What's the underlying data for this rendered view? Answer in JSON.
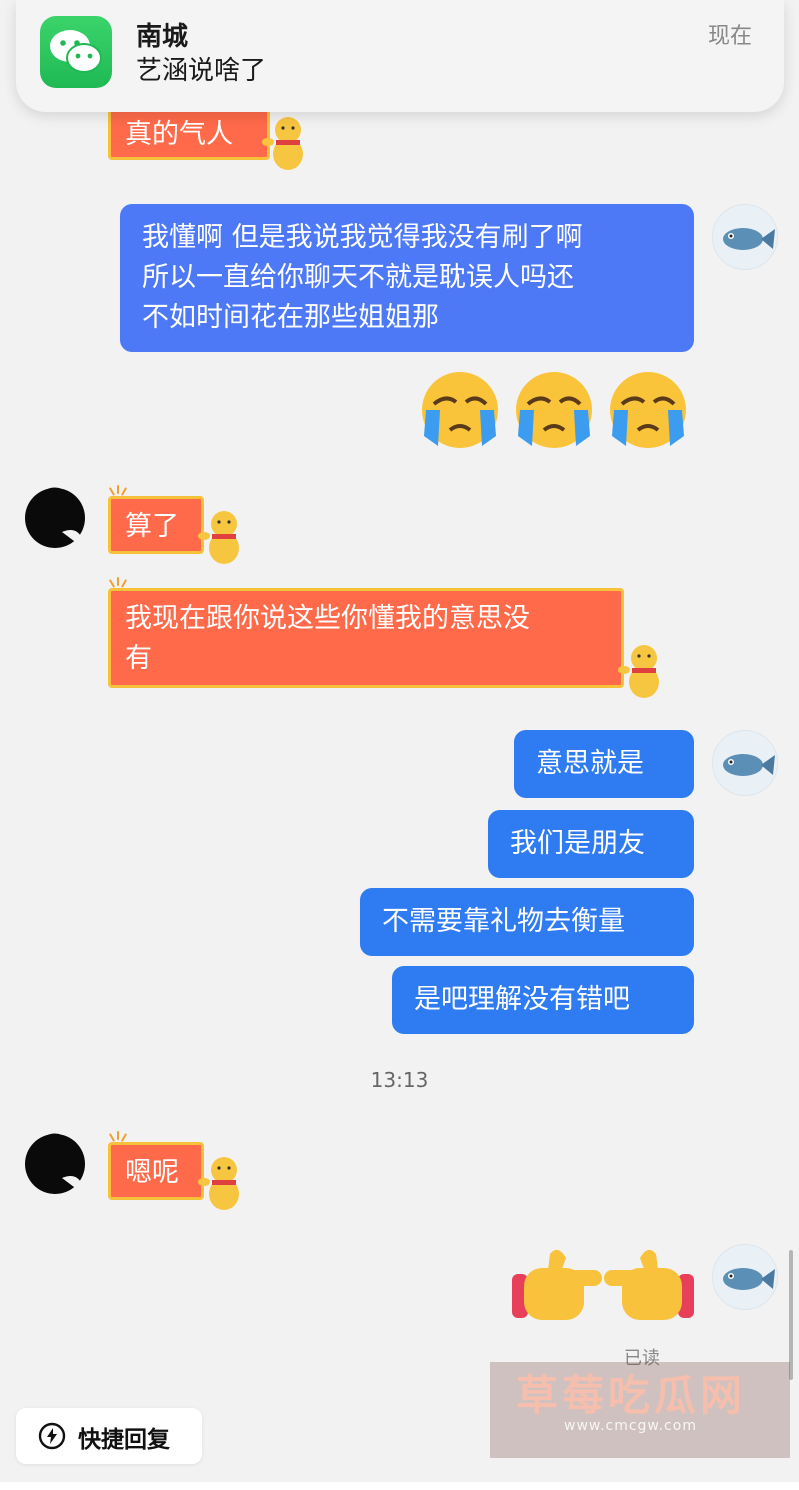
{
  "notification": {
    "app_icon": "wechat-icon",
    "title": "南城",
    "message": "艺涵说啥了",
    "time": "现在"
  },
  "messages": {
    "m0": "真的气人",
    "m1": [
      "我懂啊 但是我说我觉得我没有刷了啊",
      "所以一直给你聊天不就是耽误人吗还",
      "不如时间花在那些姐姐那"
    ],
    "m2_emoji": "😭😭😭",
    "m3": "算了",
    "m4": [
      "我现在跟你说这些你懂我的意思没",
      "有"
    ],
    "m5": "意思就是",
    "m6": "我们是朋友",
    "m7": "不需要靠礼物去衡量",
    "m8": "是吧理解没有错吧",
    "timestamp": "13:13",
    "m9": "嗯呢",
    "m10_emoji": "👉👈"
  },
  "read_status": "已读",
  "quick_reply": {
    "icon": "lightning-icon",
    "label": "快捷回复"
  },
  "watermark": {
    "text": "草莓吃瓜网",
    "url": "www.cmcgw.com"
  },
  "colors": {
    "blue_bubble": "#4d79f7",
    "blue_bubble_2": "#2f7bf2",
    "orange_bubble": "#ff6a4a",
    "orange_border": "#f7c23a",
    "background": "#f2f2f2"
  }
}
